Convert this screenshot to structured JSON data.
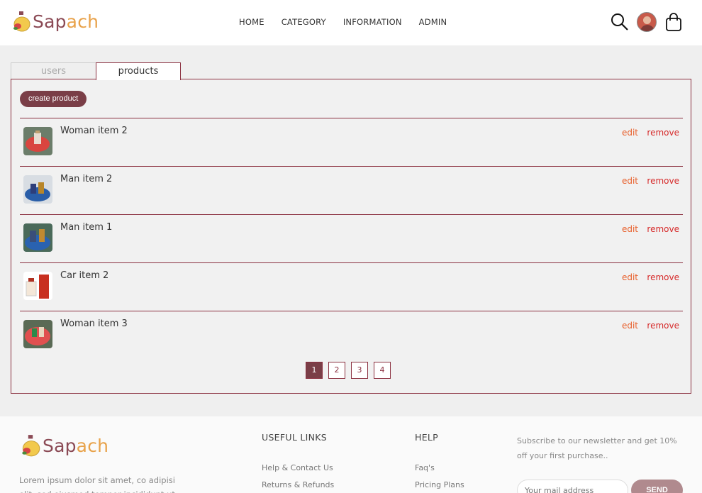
{
  "brand": {
    "part1": "Sap",
    "part2": "ach",
    "colors": {
      "primary": "#8b4a55",
      "accent": "#e8a24a"
    }
  },
  "nav": {
    "items": [
      "HOME",
      "CATEGORY",
      "INFORMATION",
      "ADMIN"
    ]
  },
  "header_icons": [
    "search-icon",
    "user-avatar",
    "shopping-bag-icon"
  ],
  "tabs": {
    "users": "users",
    "products": "products",
    "active": "products"
  },
  "create_button": "create product",
  "products": [
    {
      "name": "Woman item 2",
      "edit": "edit",
      "remove": "remove",
      "thumb": "red-plate"
    },
    {
      "name": "Man item 2",
      "edit": "edit",
      "remove": "remove",
      "thumb": "blue-plate"
    },
    {
      "name": "Man item 1",
      "edit": "edit",
      "remove": "remove",
      "thumb": "blue-plate"
    },
    {
      "name": "Car item 2",
      "edit": "edit",
      "remove": "remove",
      "thumb": "red-box"
    },
    {
      "name": "Woman item 3",
      "edit": "edit",
      "remove": "remove",
      "thumb": "red-plate"
    }
  ],
  "pagination": {
    "pages": [
      "1",
      "2",
      "3",
      "4"
    ],
    "current": "1"
  },
  "footer": {
    "lorem": "Lorem ipsum dolor sit amet, co adipisi elit, sed eiusmod tempor incididunt ut",
    "useful_links_title": "USEFUL LINKS",
    "useful_links": [
      "Help & Contact Us",
      "Returns & Refunds"
    ],
    "help_title": "HELP",
    "help_links": [
      "Faq's",
      "Pricing Plans"
    ],
    "newsletter_text": "Subscribe to our newsletter and get 10% off your first purchase..",
    "email_placeholder": "Your mail address",
    "send_label": "SEND"
  },
  "colors": {
    "accent": "#8b3040",
    "button": "#7a3e47",
    "edit": "#e8602c",
    "remove": "#d62a2a"
  }
}
